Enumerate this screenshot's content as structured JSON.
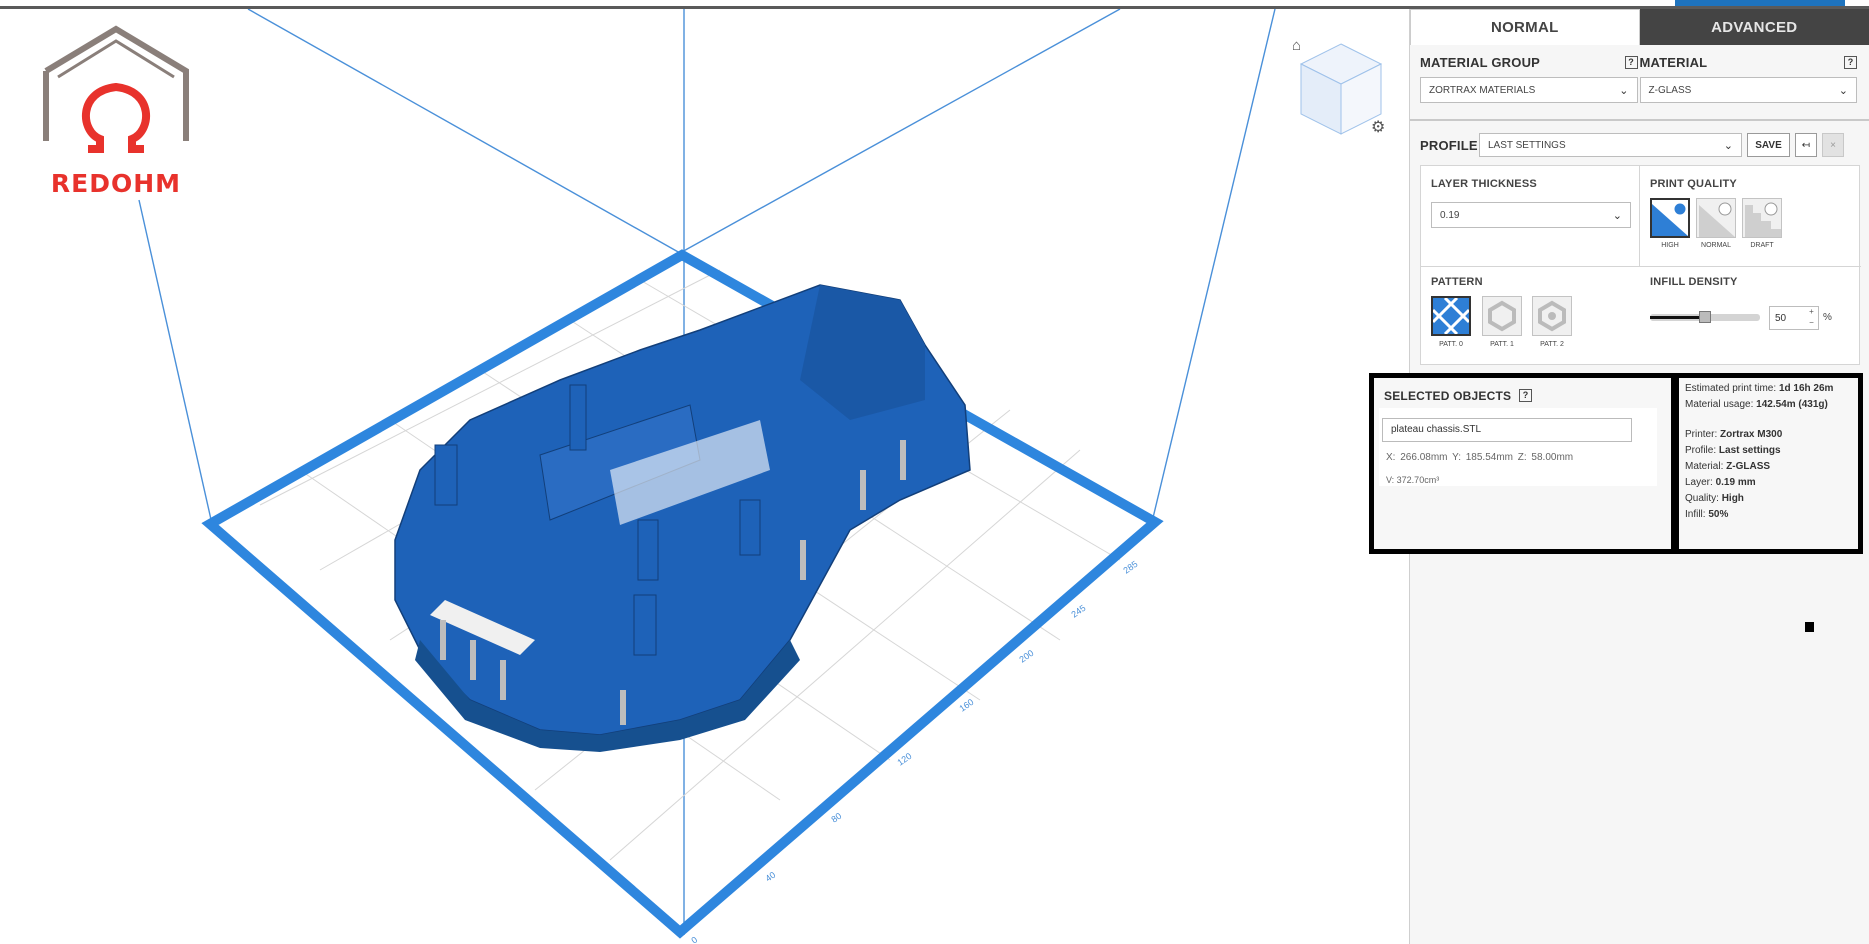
{
  "branding": {
    "logo_text": "REDOHM"
  },
  "viewport": {
    "axis_ticks": [
      "0",
      "40",
      "80",
      "120",
      "160",
      "200",
      "245",
      "285"
    ]
  },
  "tabs": [
    {
      "label": "NORMAL",
      "active": true
    },
    {
      "label": "ADVANCED",
      "active": false
    }
  ],
  "material_group": {
    "label": "MATERIAL GROUP",
    "value": "ZORTRAX MATERIALS"
  },
  "material": {
    "label": "MATERIAL",
    "value": "Z-GLASS"
  },
  "profile": {
    "label": "PROFILE",
    "value": "LAST SETTINGS",
    "save_label": "SAVE"
  },
  "layer_thickness": {
    "label": "LAYER THICKNESS",
    "value": "0.19"
  },
  "print_quality": {
    "label": "PRINT QUALITY",
    "options": [
      "HIGH",
      "NORMAL",
      "DRAFT"
    ],
    "selected": "HIGH"
  },
  "pattern": {
    "label": "PATTERN",
    "options": [
      "PATT. 0",
      "PATT. 1",
      "PATT. 2"
    ],
    "selected": "PATT. 0"
  },
  "infill": {
    "label": "INFILL DENSITY",
    "value": "50",
    "unit": "%",
    "fraction": 0.5
  },
  "selected_objects": {
    "title": "SELECTED OBJECTS",
    "name": "plateau chassis.STL",
    "dims": "X: 266.08mm   Y: 185.54mm   Z: 58.00mm",
    "volume": "V: 372.70cm³"
  },
  "summary": {
    "print_time_label": "Estimated print time:",
    "print_time": "1d 16h 26m",
    "material_usage_label": "Material usage:",
    "material_usage": "142.54m (431g)",
    "printer_label": "Printer:",
    "printer": "Zortrax M300",
    "profile_label": "Profile:",
    "profile": "Last settings",
    "material_label": "Material:",
    "material": "Z-GLASS",
    "layer_label": "Layer:",
    "layer": "0.19 mm",
    "quality_label": "Quality:",
    "quality": "High",
    "infill_label": "Infill:",
    "infill": "50%"
  },
  "icons": [
    "home-icon",
    "gear-icon",
    "help-icon",
    "chevron-down-icon",
    "undo-icon",
    "close-icon"
  ],
  "colors": {
    "model_blue": "#1e62b8",
    "grid_blue": "#2e86de",
    "tab_dark": "#444444",
    "logo_red": "#e8322c"
  }
}
